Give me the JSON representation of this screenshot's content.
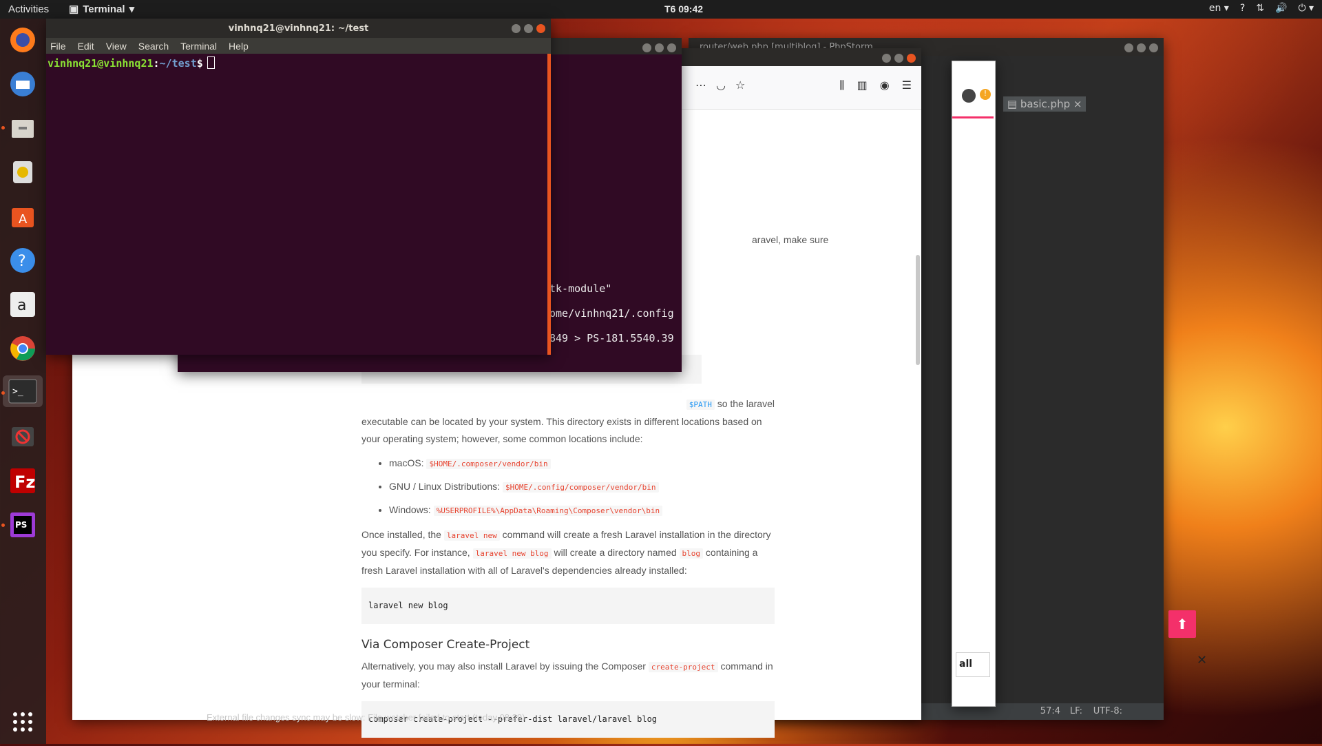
{
  "topbar": {
    "activities": "Activities",
    "app_name": "Terminal",
    "clock": "T6 09:42",
    "lang": "en"
  },
  "dock": {
    "items": [
      "firefox-icon",
      "thunderbird-icon",
      "files-icon",
      "rhythmbox-icon",
      "software-icon",
      "help-icon",
      "amazon-icon",
      "chrome-icon",
      "terminal-icon",
      "blocked-icon",
      "filezilla-icon",
      "phpstorm-icon"
    ],
    "apps_grid": "show-apps-icon"
  },
  "terminal": {
    "title": "vinhnq21@vinhnq21: ~/test",
    "menu": [
      "File",
      "Edit",
      "View",
      "Search",
      "Terminal",
      "Help"
    ],
    "prompt_user": "vinhnq21@vinhnq21",
    "prompt_sep": ":",
    "prompt_path": "~/test",
    "prompt_symbol": "$"
  },
  "term2": {
    "lines": [
      "tk-module\"",
      "ome/vinhnq21/.config",
      "849 > PS-181.5540.39"
    ]
  },
  "phpstorm": {
    "title": "router/web.php [multiblog] - PhpStorm",
    "tab_partial": "p",
    "tab_file": "basic.php",
    "status_pos": "57:4",
    "status_lf": "LF:",
    "status_enc": "UTF-8:",
    "notice": "External file changes sync may be slow: File watcher failed to start (today 08:29)"
  },
  "doc": {
    "partial_line": "aravel, make sure",
    "path_para_a": "so the laravel",
    "path_code": "$PATH",
    "path_para_b": "executable can be located by your system. This directory exists in different locations based on your operating system; however, some common locations include:",
    "bullets": [
      {
        "label": "macOS:",
        "code": "$HOME/.composer/vendor/bin"
      },
      {
        "label": "GNU / Linux Distributions:",
        "code": "$HOME/.config/composer/vendor/bin"
      },
      {
        "label": "Windows:",
        "code": "%USERPROFILE%\\AppData\\Roaming\\Composer\\vendor\\bin"
      }
    ],
    "installed_1": "Once installed, the",
    "installed_code1": "laravel new",
    "installed_2": "command will create a fresh Laravel installation in the directory you specify. For instance,",
    "installed_code2": "laravel new blog",
    "installed_3": "will create a directory named",
    "installed_code3": "blog",
    "installed_4": "containing a fresh Laravel installation with all of Laravel's dependencies already installed:",
    "code1": "laravel new blog",
    "heading": "Via Composer Create-Project",
    "alt_1": "Alternatively, you may also install Laravel by issuing the Composer",
    "alt_code": "create-project",
    "alt_2": "command in your terminal:",
    "code2": "composer create-project --prefer-dist laravel/laravel blog"
  },
  "right": {
    "all_label": "all"
  }
}
